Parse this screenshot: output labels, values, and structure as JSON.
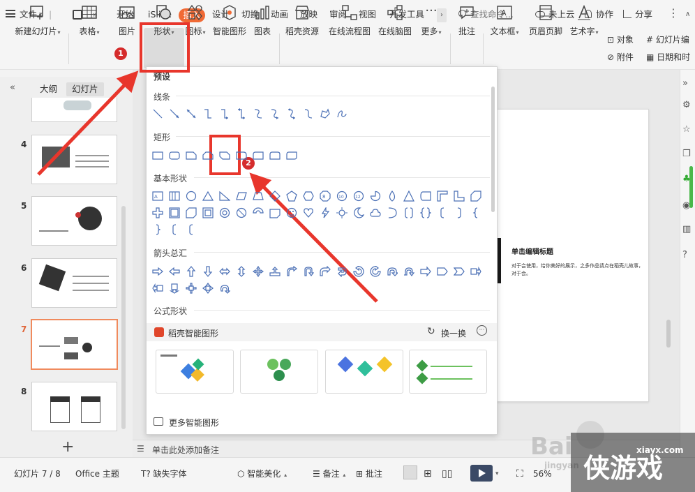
{
  "tabbar": {
    "file": "文件",
    "tabs": [
      "开始",
      "iSlide",
      "插入",
      "设计",
      "切换",
      "动画",
      "放映",
      "审阅",
      "视图",
      "开发工具"
    ],
    "search": "查找命令...",
    "cloud": "未上云",
    "collab": "协作",
    "share": "分享"
  },
  "ribbon": {
    "new_slide": "新建幻灯片",
    "table": "表格",
    "picture": "图片",
    "shape": "形状",
    "icon": "图标",
    "smartart": "智能图形",
    "chart": "图表",
    "daoke": "稻壳资源",
    "flowchart": "在线流程图",
    "mindmap": "在线脑图",
    "more": "更多",
    "comment": "批注",
    "textbox": "文本框",
    "header_footer": "页眉页脚",
    "wordart": "艺术字",
    "object": "对象",
    "slide_num": "幻灯片编",
    "attachment": "附件",
    "datetime": "日期和时"
  },
  "left_panel": {
    "tab_outline": "大纲",
    "tab_slides": "幻灯片",
    "slide_numbers": [
      "4",
      "5",
      "6",
      "7",
      "8"
    ]
  },
  "dropdown": {
    "preset": "预设",
    "lines": "线条",
    "rect": "矩形",
    "basic": "基本形状",
    "arrows": "箭头总汇",
    "formula": "公式形状",
    "smart_title": "稻壳智能图形",
    "swap": "换一换",
    "more_smart": "更多智能图形"
  },
  "slide": {
    "title": "单击编辑标题",
    "body": "对于会使用，给你美好的展示，之多作品请点在稻壳儿故事，对于会。"
  },
  "note": "单击此处添加备注",
  "status": {
    "slide_count": "幻灯片 7 / 8",
    "theme": "Office 主题",
    "missing_font": "缺失字体",
    "beautify": "智能美化",
    "notes": "备注",
    "comments": "批注",
    "zoom": "56%"
  },
  "annotations": {
    "badge1": "1",
    "badge2": "2"
  },
  "watermark": {
    "baidu": "Bai",
    "brand": "侠游戏",
    "domain": "xiayx.com",
    "jingyan": "jingyan"
  },
  "colors": {
    "accent": "#f06a35",
    "annotation_red": "#e8362c",
    "shape_blue": "#4a6fb5"
  }
}
